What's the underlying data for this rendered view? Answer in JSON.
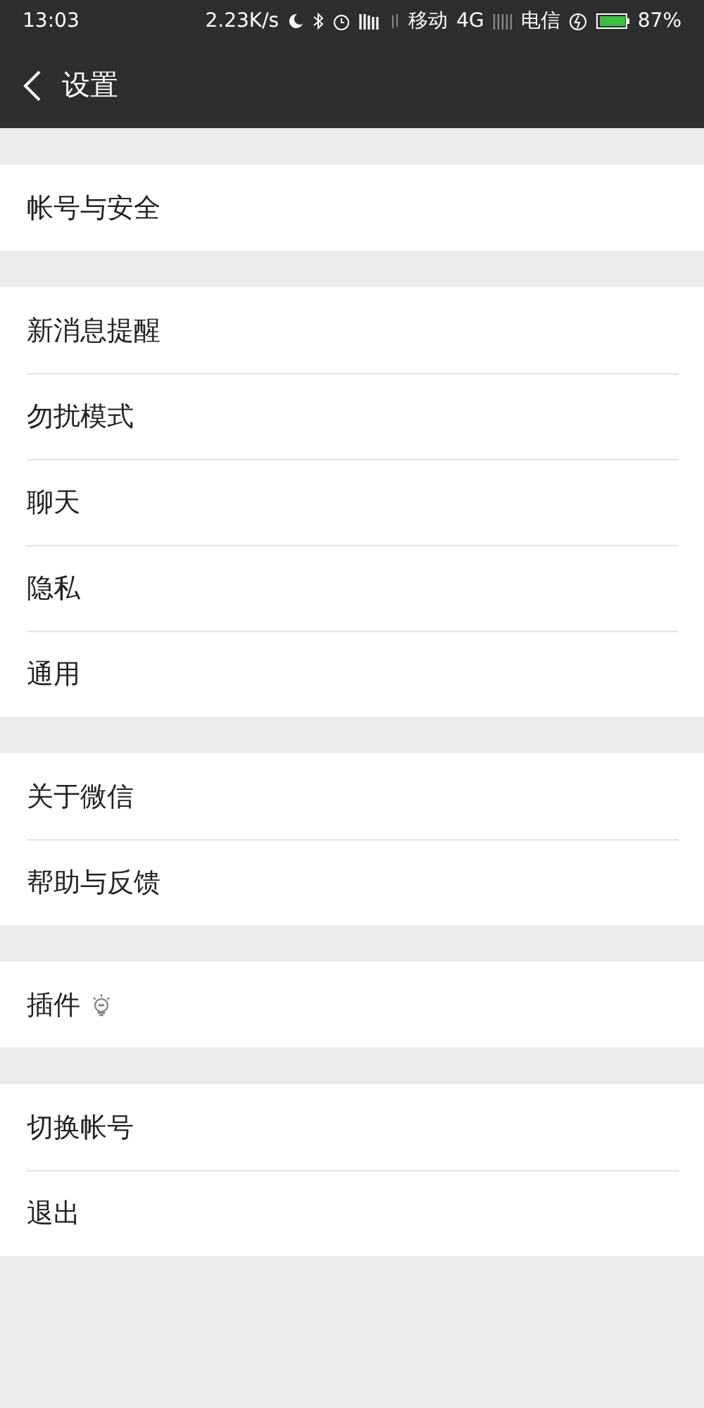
{
  "status_bar": {
    "time": "13:03",
    "speed": "2.23K/s",
    "carrier_1": "移动",
    "network": "4G",
    "carrier_2": "电信",
    "battery": "87%"
  },
  "header": {
    "title": "设置"
  },
  "sections": [
    {
      "items": [
        {
          "label": "帐号与安全",
          "kind": "plain"
        }
      ]
    },
    {
      "items": [
        {
          "label": "新消息提醒",
          "kind": "plain"
        },
        {
          "label": "勿扰模式",
          "kind": "plain"
        },
        {
          "label": "聊天",
          "kind": "plain"
        },
        {
          "label": "隐私",
          "kind": "plain"
        },
        {
          "label": "通用",
          "kind": "plain"
        }
      ]
    },
    {
      "items": [
        {
          "label": "关于微信",
          "kind": "plain"
        },
        {
          "label": "帮助与反馈",
          "kind": "plain"
        }
      ]
    },
    {
      "items": [
        {
          "label": "插件",
          "kind": "with-icon"
        }
      ]
    },
    {
      "items": [
        {
          "label": "切换帐号",
          "kind": "plain"
        },
        {
          "label": "退出",
          "kind": "plain"
        }
      ]
    }
  ]
}
